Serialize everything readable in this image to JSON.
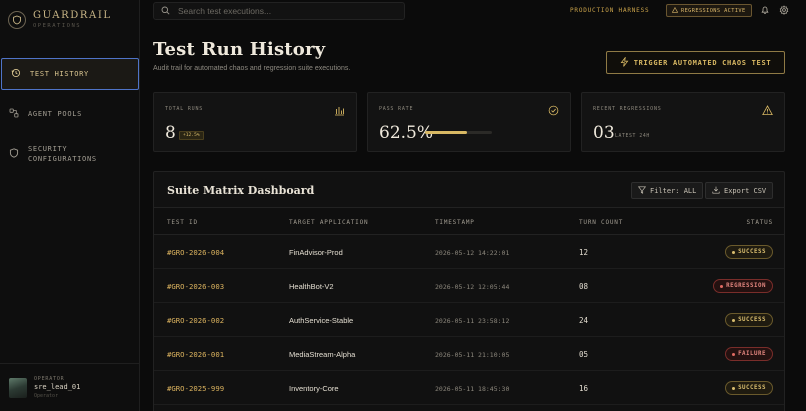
{
  "brand": {
    "title": "GUARDRAIL",
    "subtitle": "OPERATIONS"
  },
  "sidebar": {
    "items": [
      {
        "label": "TEST HISTORY",
        "icon": "history-icon",
        "active": true
      },
      {
        "label": "AGENT POOLS",
        "icon": "nodes-icon",
        "active": false
      },
      {
        "label": "SECURITY CONFIGURATIONS",
        "icon": "shield-icon",
        "active": false
      }
    ]
  },
  "operator": {
    "role": "OPERATOR",
    "name": "sre_lead_01",
    "subtitle": "Operator"
  },
  "search": {
    "placeholder": "Search test executions..."
  },
  "topbar": {
    "environment": "PRODUCTION HARNESS",
    "badge": "REGRESSIONS ACTIVE"
  },
  "header": {
    "title": "Test Run History",
    "subtitle": "Audit trail for automated chaos and regression suite executions.",
    "trigger_label": "TRIGGER AUTOMATED CHAOS TEST"
  },
  "stats": {
    "total_runs": {
      "label": "TOTAL RUNS",
      "value": "8",
      "delta": "+12.5%"
    },
    "pass_rate": {
      "label": "PASS RATE",
      "value": "62.5%",
      "progress": 0.625
    },
    "recent_regressions": {
      "label": "RECENT REGRESSIONS",
      "value": "03",
      "note": "LATEST 24H"
    }
  },
  "table": {
    "title": "Suite Matrix Dashboard",
    "filter_label": "Filter: ALL",
    "export_label": "Export CSV",
    "headers": [
      "TEST ID",
      "TARGET APPLICATION",
      "TIMESTAMP",
      "TURN COUNT",
      "STATUS"
    ],
    "rows": [
      {
        "id": "#GRO-2026-004",
        "app": "FinAdvisor-Prod",
        "timestamp": "2026-05-12 14:22:01",
        "turns": "12",
        "status": "SUCCESS"
      },
      {
        "id": "#GRO-2026-003",
        "app": "HealthBot-V2",
        "timestamp": "2026-05-12 12:05:44",
        "turns": "08",
        "status": "REGRESSION"
      },
      {
        "id": "#GRO-2026-002",
        "app": "AuthService-Stable",
        "timestamp": "2026-05-11 23:58:12",
        "turns": "24",
        "status": "SUCCESS"
      },
      {
        "id": "#GRO-2026-001",
        "app": "MediaStream-Alpha",
        "timestamp": "2026-05-11 21:10:05",
        "turns": "05",
        "status": "FAILURE"
      },
      {
        "id": "#GRO-2025-999",
        "app": "Inventory-Core",
        "timestamp": "2026-05-11 18:45:30",
        "turns": "16",
        "status": "SUCCESS"
      }
    ]
  },
  "colors": {
    "accent": "#d8b863",
    "danger": "#e06a62",
    "background": "#0b0b0b",
    "active_outline": "#4f74c8"
  }
}
